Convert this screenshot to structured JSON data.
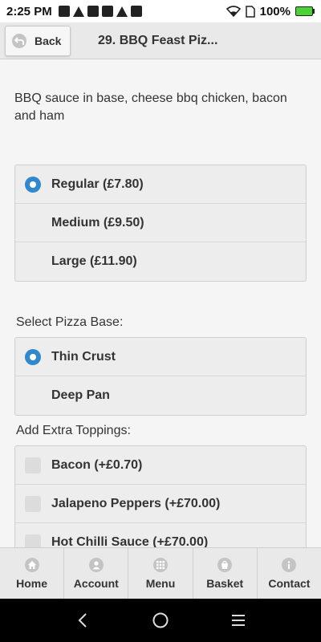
{
  "status_bar": {
    "time": "2:25 PM",
    "battery": "100%"
  },
  "header": {
    "back_label": "Back",
    "title": "29. BBQ Feast Piz..."
  },
  "description": "BBQ sauce in base, cheese bbq chicken, bacon and ham",
  "size_options": [
    {
      "label": "Regular (£7.80)",
      "selected": true
    },
    {
      "label": "Medium (£9.50)",
      "selected": false
    },
    {
      "label": "Large (£11.90)",
      "selected": false
    }
  ],
  "base_section": {
    "label": "Select Pizza Base:",
    "options": [
      {
        "label": "Thin Crust",
        "selected": true
      },
      {
        "label": "Deep Pan",
        "selected": false
      }
    ]
  },
  "toppings_section": {
    "label": "Add Extra Toppings:",
    "options": [
      {
        "label": "Bacon (+£0.70)",
        "checked": false
      },
      {
        "label": "Jalapeno Peppers (+£70.00)",
        "checked": false
      },
      {
        "label": "Hot Chilli Sauce (+£70.00)",
        "checked": false
      }
    ]
  },
  "bottom_nav": [
    {
      "label": "Home",
      "icon": "home-icon"
    },
    {
      "label": "Account",
      "icon": "user-icon"
    },
    {
      "label": "Menu",
      "icon": "grid-icon"
    },
    {
      "label": "Basket",
      "icon": "basket-icon"
    },
    {
      "label": "Contact",
      "icon": "info-icon"
    }
  ],
  "colors": {
    "accent": "#3388cc",
    "header_bg": "#e9e9e9",
    "option_bg": "#ededed"
  }
}
